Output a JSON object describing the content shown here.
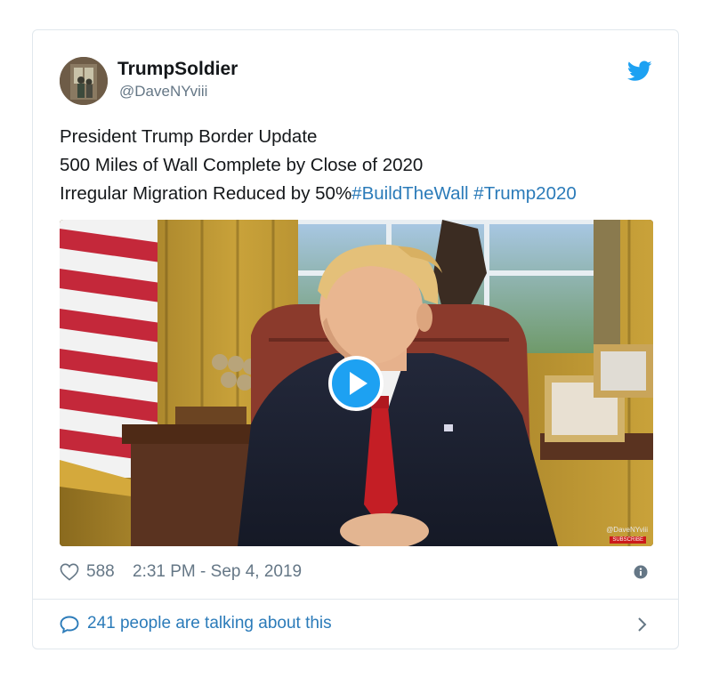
{
  "user": {
    "display_name": "TrumpSoldier",
    "handle": "@DaveNYviii"
  },
  "tweet": {
    "line1": "President Trump Border Update",
    "line2": "500 Miles of Wall Complete by Close of 2020",
    "line3_text": "Irregular Migration Reduced by 50%",
    "hashtag1": "#BuildTheWall",
    "hashtag2": "#Trump2020"
  },
  "media": {
    "watermark": "@DaveNYviii",
    "badge": "SUBSCRIBE"
  },
  "footer": {
    "like_count": "588",
    "timestamp": "2:31 PM - Sep 4, 2019"
  },
  "conversation": {
    "label": "241 people are talking about this"
  },
  "colors": {
    "link": "#2b7bb9",
    "twitter_blue": "#1da1f2",
    "muted": "#657786",
    "border": "#e1e8ed"
  },
  "icons": [
    "twitter-bird-icon",
    "play-icon",
    "heart-icon",
    "info-icon",
    "speech-bubble-icon",
    "chevron-right-icon"
  ]
}
